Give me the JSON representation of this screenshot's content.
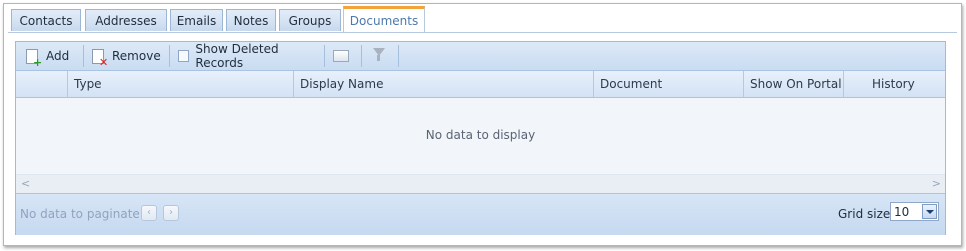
{
  "tabs": [
    {
      "label": "Contacts"
    },
    {
      "label": "Addresses"
    },
    {
      "label": "Emails"
    },
    {
      "label": "Notes"
    },
    {
      "label": "Groups"
    },
    {
      "label": "Documents",
      "active": true
    }
  ],
  "toolbar": {
    "add_label": "Add",
    "remove_label": "Remove",
    "show_deleted_label": "Show Deleted Records"
  },
  "columns": [
    "Type",
    "Display Name",
    "Document",
    "Show On Portal",
    "History"
  ],
  "grid": {
    "empty_text": "No data to display",
    "scroll_left": "<",
    "scroll_right": ">"
  },
  "pager": {
    "text": "No data to paginate",
    "prev": "‹",
    "next": "›",
    "size_label": "Grid size:",
    "size_value": "10"
  }
}
